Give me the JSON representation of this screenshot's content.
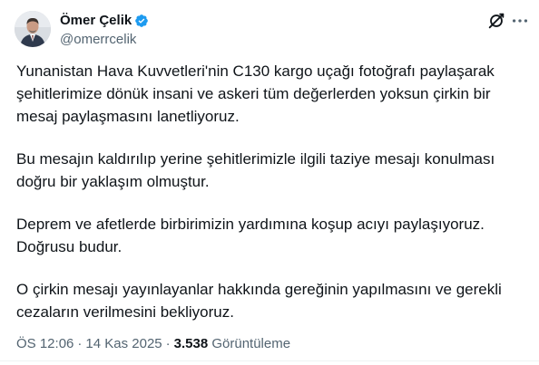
{
  "author": {
    "display_name": "Ömer Çelik",
    "handle": "@omerrcelik",
    "verified": true,
    "verified_color": "#1d9bf0"
  },
  "icons": {
    "grok": "grok-icon",
    "more": "more-options-icon"
  },
  "tweet": {
    "paragraphs": [
      "Yunanistan Hava Kuvvetleri'nin C130 kargo uçağı fotoğrafı paylaşarak şehitlerimize dönük insani ve askeri tüm değerlerden yoksun çirkin bir mesaj paylaşmasını lanetliyoruz.",
      "Bu mesajın kaldırılıp yerine şehitlerimizle ilgili taziye mesajı konulması doğru bir yaklaşım olmuştur.",
      "Deprem ve afetlerde birbirimizin yardımına koşup acıyı paylaşıyoruz. Doğrusu budur.",
      "O çirkin mesajı yayınlayanlar hakkında gereğinin yapılmasını ve gerekli cezaların verilmesini bekliyoruz."
    ]
  },
  "meta": {
    "time": "ÖS 12:06",
    "separator": "·",
    "date": "14 Kas 2025",
    "views_count": "3.538",
    "views_label": "Görüntüleme"
  }
}
